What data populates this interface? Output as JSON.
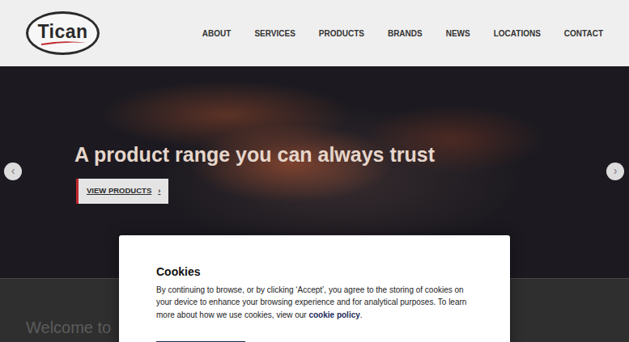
{
  "logo": {
    "text": "Tican"
  },
  "nav": [
    {
      "label": "ABOUT"
    },
    {
      "label": "SERVICES"
    },
    {
      "label": "PRODUCTS"
    },
    {
      "label": "BRANDS"
    },
    {
      "label": "NEWS"
    },
    {
      "label": "LOCATIONS"
    },
    {
      "label": "CONTACT"
    }
  ],
  "hero": {
    "headline": "A product range you can always trust",
    "button": "VIEW PRODUCTS",
    "button_icon": "›",
    "prev_icon": "‹",
    "next_icon": "›"
  },
  "welcome": {
    "text": "Welcome to"
  },
  "cookie_dialog": {
    "title": "Cookies",
    "body": "By continuing to browse, or by clicking ‘Accept’, you agree to the storing of cookies on your device to enhance your browsing experience and for analytical purposes. To learn more about how we use cookies, view our ",
    "link": "cookie policy",
    "end": "."
  }
}
